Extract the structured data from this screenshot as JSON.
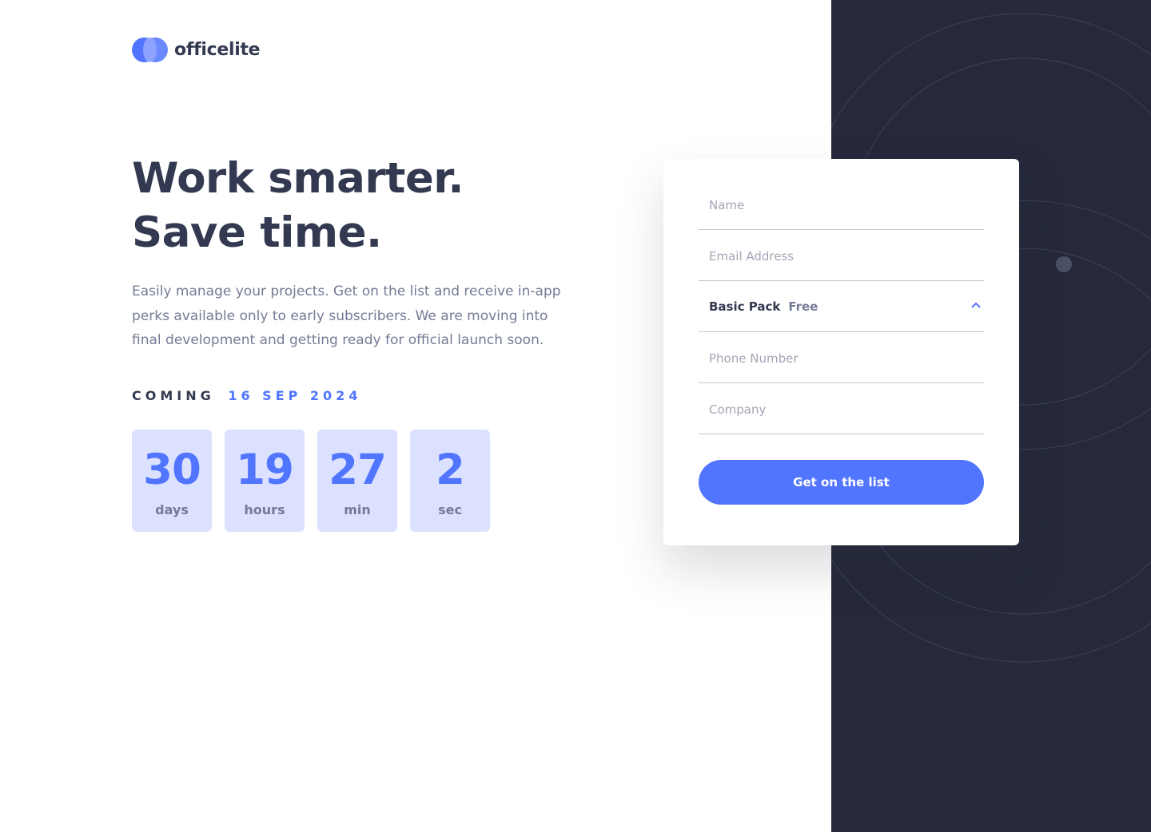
{
  "brand": {
    "name": "officelite",
    "accent_color": "#5175ff",
    "dark_color": "#25293a"
  },
  "hero": {
    "headline": "Work smarter. Save time.",
    "description": "Easily manage your projects. Get on the list and receive in-app perks available only to early subscribers. We are moving into final development and getting ready for official launch soon."
  },
  "launch": {
    "label": "COMING",
    "date": "16 SEP 2024"
  },
  "countdown": {
    "days": {
      "value": "30",
      "unit": "days"
    },
    "hours": {
      "value": "19",
      "unit": "hours"
    },
    "minutes": {
      "value": "27",
      "unit": "min"
    },
    "seconds": {
      "value": "2",
      "unit": "sec"
    }
  },
  "form": {
    "name_placeholder": "Name",
    "email_placeholder": "Email Address",
    "plan": {
      "selected": "Basic Pack",
      "price": "Free",
      "icon": "chevron-up-icon"
    },
    "phone_placeholder": "Phone Number",
    "company_placeholder": "Company",
    "submit_label": "Get on the list"
  }
}
